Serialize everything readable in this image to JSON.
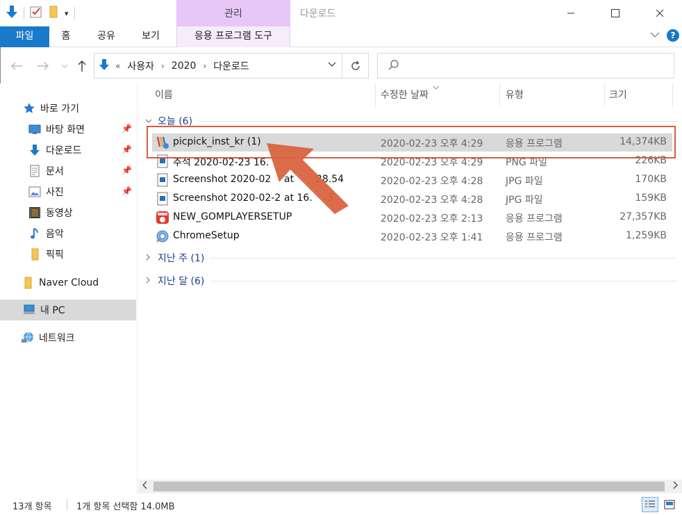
{
  "window": {
    "title": "다운로드",
    "contextual_group": "관리"
  },
  "ribbon": {
    "tabs": [
      "파일",
      "홈",
      "공유",
      "보기",
      "응용 프로그램 도구"
    ],
    "help": "?"
  },
  "address": {
    "overflow": "«",
    "crumbs": [
      "사용자",
      "2020",
      "다운로드"
    ],
    "search_placeholder": ""
  },
  "sidebar": {
    "items": [
      {
        "label": "바로 가기",
        "icon": "star-icon"
      },
      {
        "label": "바탕 화면",
        "icon": "desktop-icon",
        "pinned": true
      },
      {
        "label": "다운로드",
        "icon": "download-icon",
        "pinned": true
      },
      {
        "label": "문서",
        "icon": "document-icon",
        "pinned": true
      },
      {
        "label": "사진",
        "icon": "picture-icon",
        "pinned": true
      },
      {
        "label": "동영상",
        "icon": "video-icon"
      },
      {
        "label": "음악",
        "icon": "music-icon"
      },
      {
        "label": "픽픽",
        "icon": "folder-icon"
      },
      {
        "label": "Naver Cloud",
        "icon": "folder-icon"
      },
      {
        "label": "내 PC",
        "icon": "pc-icon",
        "selected": true
      },
      {
        "label": "네트워크",
        "icon": "network-icon"
      }
    ]
  },
  "columns": {
    "name": "이름",
    "date": "수정한 날짜",
    "type": "유형",
    "size": "크기"
  },
  "groups": {
    "today": "오늘 (6)",
    "last_week": "지난 주 (1)",
    "last_month": "지난 달 (6)"
  },
  "files": [
    {
      "name": "picpick_inst_kr (1)",
      "date": "2020-02-23 오후 4:29",
      "type": "응용 프로그램",
      "size": "14,374KB",
      "icon": "picpick-app-icon",
      "selected": true
    },
    {
      "name": "추석 2020-02-23 16.",
      "date": "2020-02-23 오후 4:29",
      "type": "PNG 파일",
      "size": "226KB",
      "icon": "image-file-icon"
    },
    {
      "name": "Screenshot 2020-02",
      "name_tail": "at",
      "name_tail2": "28.54",
      "date": "2020-02-23 오후 4:28",
      "type": "JPG 파일",
      "size": "170KB",
      "icon": "image-file-icon"
    },
    {
      "name": "Screenshot 2020-02-2",
      "name_tail": "at 16.",
      "name_tail2": "3",
      "date": "2020-02-23 오후 4:28",
      "type": "JPG 파일",
      "size": "159KB",
      "icon": "image-file-icon"
    },
    {
      "name": "NEW_GOMPLAYERSETUP",
      "date": "2020-02-23 오후 2:13",
      "type": "응용 프로그램",
      "size": "27,357KB",
      "icon": "gomplayer-icon"
    },
    {
      "name": "ChromeSetup",
      "date": "2020-02-23 오후 1:41",
      "type": "응용 프로그램",
      "size": "1,259KB",
      "icon": "chrome-setup-icon"
    }
  ],
  "status": {
    "count": "13개 항목",
    "selection": "1개 항목 선택함 14.0MB"
  },
  "colors": {
    "accent": "#1979ca",
    "contextual": "#e6c7f7",
    "annotation": "#d95b3e"
  }
}
